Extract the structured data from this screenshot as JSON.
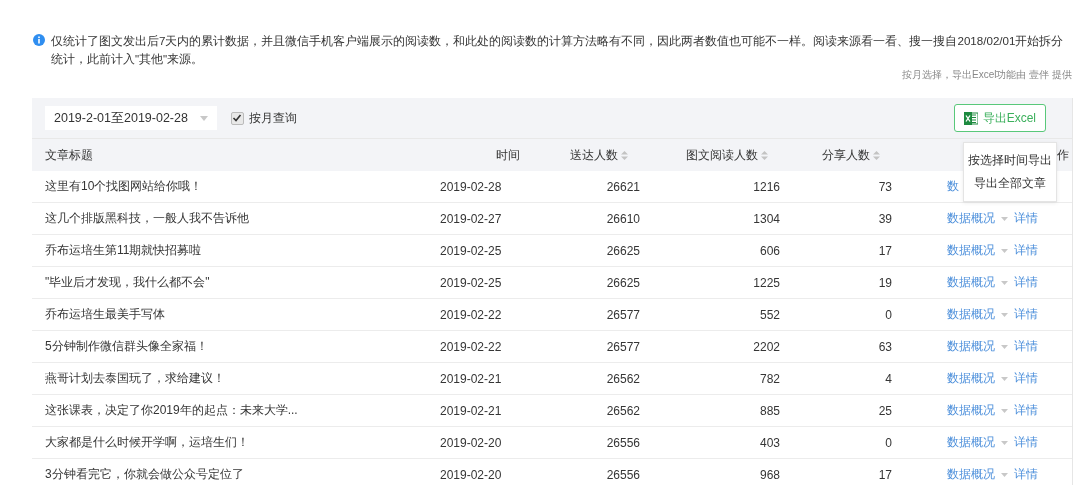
{
  "notice": {
    "text": "仅统计了图文发出后7天内的累计数据，并且微信手机客户端展示的阅读数，和此处的阅读数的计算方法略有不同，因此两者数值也可能不一样。阅读来源看一看、搜一搜自2018/02/01开始拆分统计，此前计入\"其他\"来源。"
  },
  "credit": "按月选择，导出Excel功能由 壹伴 提供",
  "toolbar": {
    "date_range": "2019-2-01至2019-02-28",
    "month_query": {
      "label": "按月查询",
      "checked": true
    },
    "export_button": "导出Excel"
  },
  "export_menu": {
    "items": [
      "按选择时间导出",
      "导出全部文章"
    ]
  },
  "table": {
    "columns": [
      {
        "label": "文章标题",
        "sortable": false
      },
      {
        "label": "时间",
        "sortable": false
      },
      {
        "label": "送达人数",
        "sortable": true
      },
      {
        "label": "图文阅读人数",
        "sortable": true
      },
      {
        "label": "分享人数",
        "sortable": true
      },
      {
        "label": "作",
        "sortable": false
      }
    ],
    "rows": [
      {
        "title": "这里有10个找图网站给你哦！",
        "time": "2019-02-28",
        "delivered": "26621",
        "reads": "1216",
        "shares": "73",
        "overview": "数"
      },
      {
        "title": "这几个排版黑科技，一般人我不告诉他",
        "time": "2019-02-27",
        "delivered": "26610",
        "reads": "1304",
        "shares": "39",
        "overview": "数据概况",
        "details": "详情"
      },
      {
        "title": "乔布运培生第11期就快招募啦",
        "time": "2019-02-25",
        "delivered": "26625",
        "reads": "606",
        "shares": "17",
        "overview": "数据概况",
        "details": "详情"
      },
      {
        "title": "\"毕业后才发现，我什么都不会\"",
        "time": "2019-02-25",
        "delivered": "26625",
        "reads": "1225",
        "shares": "19",
        "overview": "数据概况",
        "details": "详情"
      },
      {
        "title": "乔布运培生最美手写体",
        "time": "2019-02-22",
        "delivered": "26577",
        "reads": "552",
        "shares": "0",
        "overview": "数据概况",
        "details": "详情"
      },
      {
        "title": "5分钟制作微信群头像全家福！",
        "time": "2019-02-22",
        "delivered": "26577",
        "reads": "2202",
        "shares": "63",
        "overview": "数据概况",
        "details": "详情"
      },
      {
        "title": "燕哥计划去泰国玩了，求给建议！",
        "time": "2019-02-21",
        "delivered": "26562",
        "reads": "782",
        "shares": "4",
        "overview": "数据概况",
        "details": "详情"
      },
      {
        "title": "这张课表，决定了你2019年的起点：未来大学...",
        "time": "2019-02-21",
        "delivered": "26562",
        "reads": "885",
        "shares": "25",
        "overview": "数据概况",
        "details": "详情"
      },
      {
        "title": "大家都是什么时候开学啊，运培生们！",
        "time": "2019-02-20",
        "delivered": "26556",
        "reads": "403",
        "shares": "0",
        "overview": "数据概况",
        "details": "详情"
      },
      {
        "title": "3分钟看完它，你就会做公众号定位了",
        "time": "2019-02-20",
        "delivered": "26556",
        "reads": "968",
        "shares": "17",
        "overview": "数据概况",
        "details": "详情"
      }
    ]
  }
}
